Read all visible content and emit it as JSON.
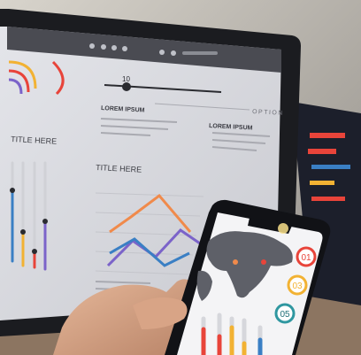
{
  "laptop_screen": {
    "toolbar_icons": [
      "circle-icon",
      "search-icon",
      "zoom-icon",
      "hand-icon",
      "pen-icon",
      "share-icon",
      "more-icon"
    ],
    "slider_value": "10",
    "section_heading_top": "LOREM IPSUM",
    "option_label": "OPTION",
    "section_heading_right": "LOREM IPSUM",
    "title_left": "TITLE HERE",
    "title_center": "TITLE HERE"
  },
  "phone_screen": {
    "badges": [
      "01",
      "03",
      "05"
    ]
  },
  "colors": {
    "accent_red": "#e8443a",
    "accent_yellow": "#f2b233",
    "accent_blue": "#3a7fc4",
    "accent_purple": "#7b63c9",
    "accent_teal": "#2f97a0"
  }
}
